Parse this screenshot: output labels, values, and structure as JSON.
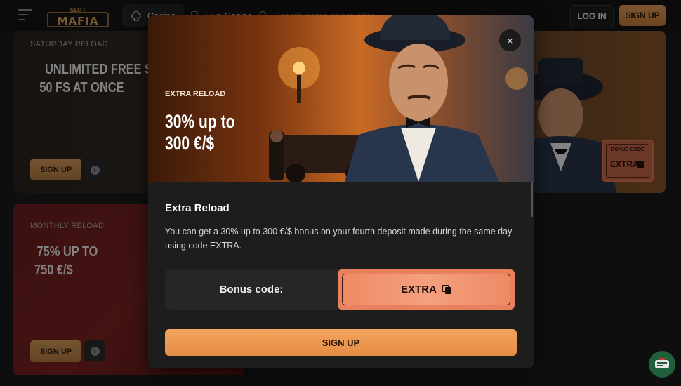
{
  "header": {
    "logo_text": "SLOT MAFIA",
    "nav": [
      {
        "label": "Casino"
      },
      {
        "label": "Live Casino"
      }
    ],
    "search_placeholder": "Search game or provider",
    "login_label": "LOG IN",
    "signup_label": "SIGN UP"
  },
  "cards": {
    "saturday": {
      "kicker": "SATURDAY RELOAD",
      "headline_1": "UNLIMITED FREE SPINS",
      "headline_2": "50 FS AT ONCE",
      "signup_label": "SIGN UP",
      "badge_label": "BONUS CODE",
      "badge_code": "EXTRA"
    },
    "monthly": {
      "kicker": "MONTHLY RELOAD",
      "headline_1": "75% UP TO",
      "headline_2": "750 €/$",
      "signup_label": "SIGN UP"
    }
  },
  "modal": {
    "hero_kicker": "EXTRA RELOAD",
    "hero_title_1": "30% up to",
    "hero_title_2": "300 €/$",
    "close_glyph": "×",
    "title": "Extra Reload",
    "description": "You can get a 30% up to 300 €/$ bonus on your fourth deposit made during the same day using code EXTRA.",
    "code_label": "Bonus code:",
    "code_value": "EXTRA",
    "signup_label": "SIGN UP"
  },
  "colors": {
    "accent": "#e48c44",
    "code_box": "#e9805e",
    "monthly_card": "#7a2322"
  }
}
